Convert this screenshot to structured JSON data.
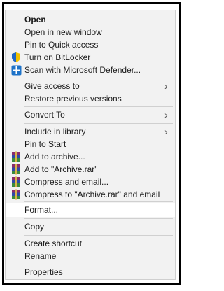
{
  "context_menu": {
    "items": {
      "open": "Open",
      "open_new_window": "Open in new window",
      "pin_quick_access": "Pin to Quick access",
      "bitlocker": "Turn on BitLocker",
      "defender": "Scan with Microsoft Defender...",
      "give_access": "Give access to",
      "restore_versions": "Restore previous versions",
      "convert_to": "Convert To",
      "include_library": "Include in library",
      "pin_start": "Pin to Start",
      "add_archive": "Add to archive...",
      "add_archive_rar": "Add to \"Archive.rar\"",
      "compress_email": "Compress and email...",
      "compress_rar_email": "Compress to \"Archive.rar\" and email",
      "format": "Format...",
      "copy": "Copy",
      "create_shortcut": "Create shortcut",
      "rename": "Rename",
      "properties": "Properties"
    },
    "submenu_chevron": "›",
    "icons": {
      "bitlocker": "shield-icon",
      "defender": "defender-icon",
      "winrar": "winrar-icon"
    },
    "hovered_item": "format"
  }
}
